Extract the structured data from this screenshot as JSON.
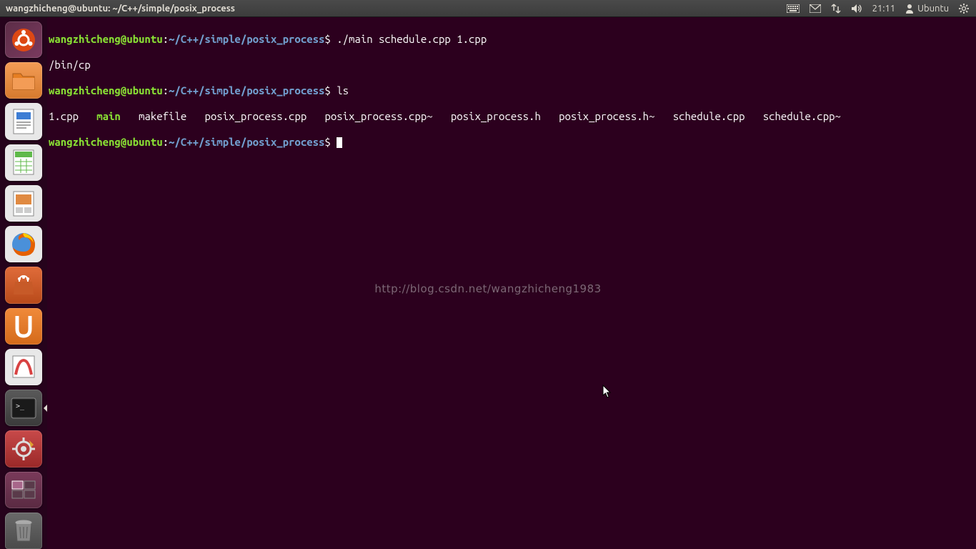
{
  "topbar": {
    "title": "wangzhicheng@ubuntu: ~/C++/simple/posix_process",
    "time": "21:11",
    "user": "Ubuntu"
  },
  "launcher": {
    "items": [
      {
        "name": "dash",
        "bg": "linear-gradient(135deg,#5c2d47,#7a3a5f)"
      },
      {
        "name": "files",
        "bg": "linear-gradient(to bottom,#f39c56,#d67a2e)"
      },
      {
        "name": "writer",
        "bg": "linear-gradient(to bottom,#3d7dd4,#1e5bb8)"
      },
      {
        "name": "calc",
        "bg": "linear-gradient(to bottom,#5fb94a,#3a8e2a)"
      },
      {
        "name": "impress",
        "bg": "linear-gradient(to bottom,#e08a42,#c76a1e)"
      },
      {
        "name": "firefox",
        "bg": "radial-gradient(circle at 30% 30%,#4a90d9,#1a5fa8)"
      },
      {
        "name": "software-center",
        "bg": "linear-gradient(to bottom,#e06c3a,#b84a1a)"
      },
      {
        "name": "ubuntu-one",
        "bg": "linear-gradient(to bottom,#f08a3a,#d46a1a)"
      },
      {
        "name": "reader",
        "bg": "linear-gradient(to bottom,#d84242,#a82020)"
      },
      {
        "name": "terminal",
        "bg": "linear-gradient(to bottom,#4a4a4a,#2a2a2a)",
        "active": true
      },
      {
        "name": "settings",
        "bg": "linear-gradient(to bottom,#b83232,#8a1818)"
      },
      {
        "name": "workspace",
        "bg": "linear-gradient(to bottom,#6a2d4e,#4a1a3a)"
      },
      {
        "name": "trash",
        "bg": "linear-gradient(to bottom,#888,#555)"
      }
    ]
  },
  "terminal": {
    "prompt_user": "wangzhicheng@ubuntu",
    "prompt_path": "~/C++/simple/posix_process",
    "cmd1": "./main schedule.cpp 1.cpp",
    "out1": "/bin/cp",
    "cmd2": "ls",
    "ls": {
      "f1": "1.cpp",
      "f2": "main",
      "f3": "makefile",
      "f4": "posix_process.cpp",
      "f5": "posix_process.cpp~",
      "f6": "posix_process.h",
      "f7": "posix_process.h~",
      "f8": "schedule.cpp",
      "f9": "schedule.cpp~"
    }
  },
  "watermark": "http://blog.csdn.net/wangzhicheng1983"
}
